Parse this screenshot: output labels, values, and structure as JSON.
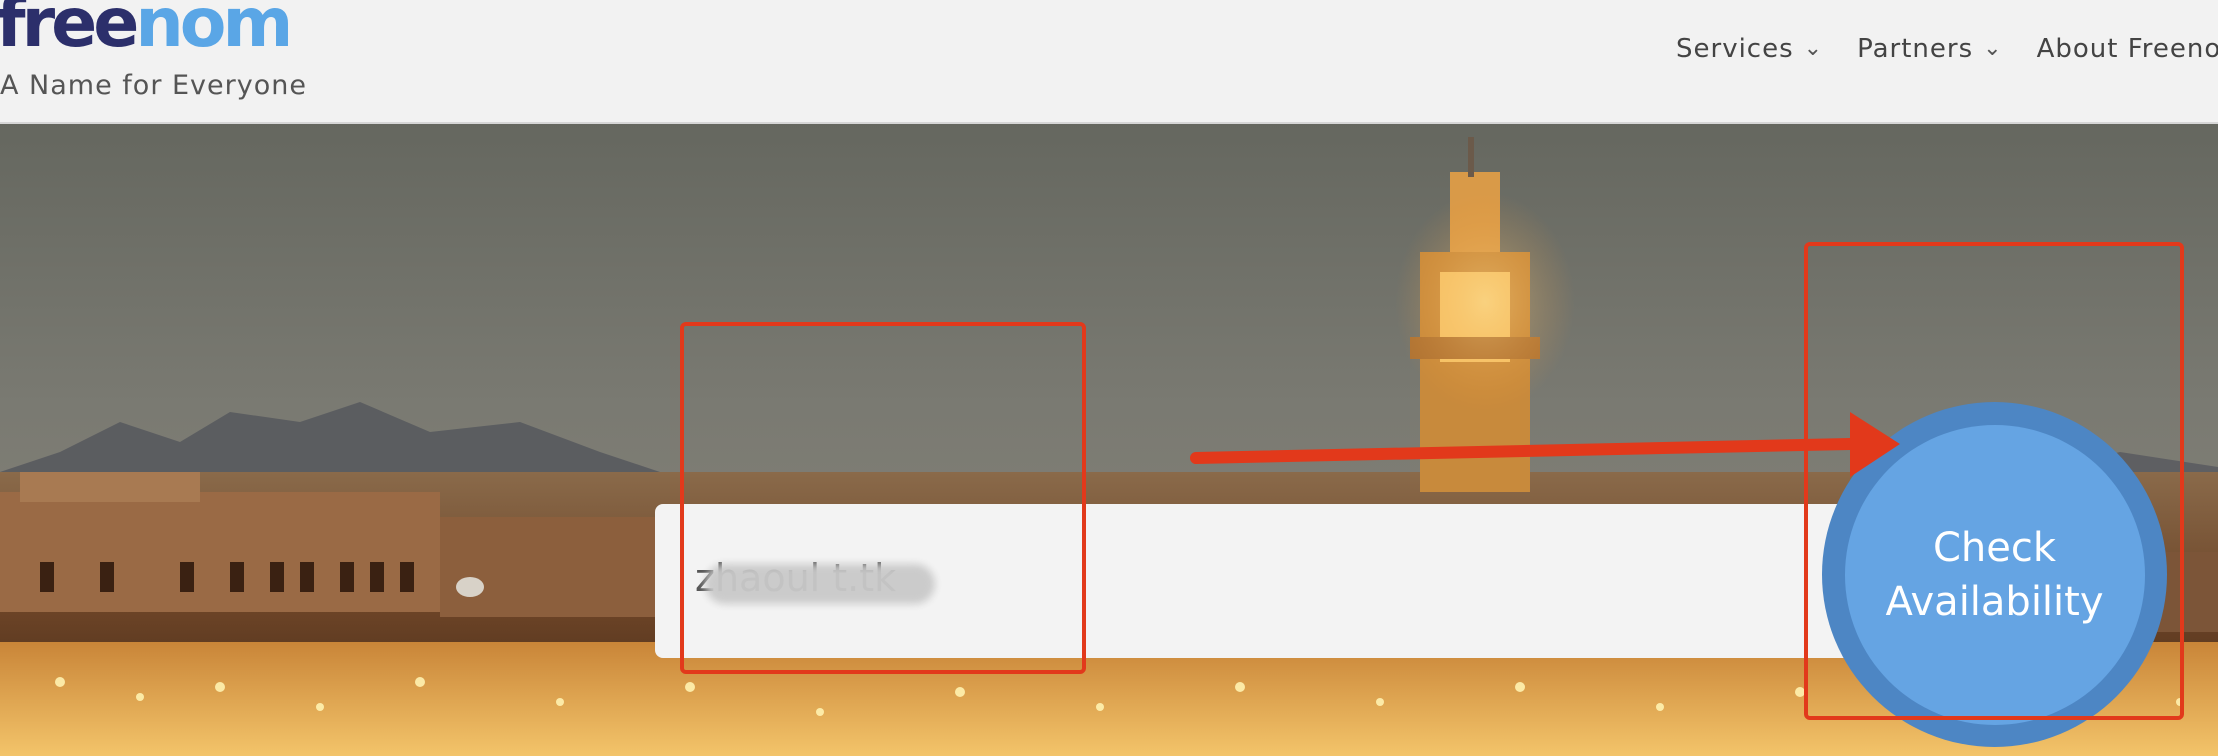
{
  "header": {
    "logo": {
      "part1": "free",
      "part2": "nom"
    },
    "tagline": "A Name for Everyone",
    "nav": [
      {
        "label": "Services",
        "icon": "chevron-down-icon"
      },
      {
        "label": "Partners",
        "icon": "chevron-down-icon"
      },
      {
        "label": "About Freenom"
      }
    ]
  },
  "search": {
    "domain_value": "zhaoul      t.tk",
    "button_label_line1": "Check",
    "button_label_line2": "Availability"
  },
  "colors": {
    "logo_dark": "#2c2f6b",
    "logo_light": "#5aa6e6",
    "button_outer": "#4d86c4",
    "button_inner": "#65a4e3",
    "annotation_red": "#e2391b"
  }
}
